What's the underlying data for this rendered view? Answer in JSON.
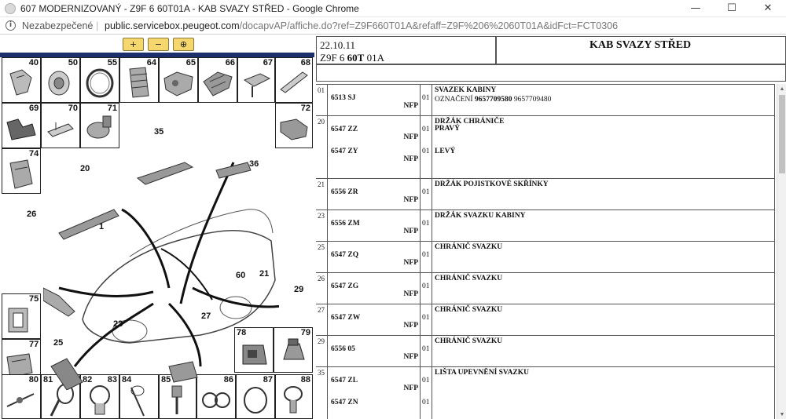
{
  "window": {
    "title": "607 MODERNIZOVANÝ - Z9F 6 60T01A - KAB SVAZY STŘED - Google Chrome",
    "minimize": "—",
    "maximize": "☐",
    "close": "✕"
  },
  "address": {
    "security": "Nezabezpečené",
    "separator": "|",
    "host": "public.servicebox.peugeot.com",
    "path": "/docapvAP/affiche.do?ref=Z9F660T01A&refaff=Z9F%206%2060T01A&idFct=FCT0306"
  },
  "toolbar": {
    "zoom_in": "+",
    "zoom_out": "−",
    "zoom_fit": "⊕"
  },
  "diagram": {
    "cells": [
      {
        "num": "40"
      },
      {
        "num": "50"
      },
      {
        "num": "55"
      },
      {
        "num": "64"
      },
      {
        "num": "65"
      },
      {
        "num": "66"
      },
      {
        "num": "67"
      },
      {
        "num": "68"
      },
      {
        "num": "69"
      },
      {
        "num": "70"
      },
      {
        "num": "71"
      },
      {
        "num": "72"
      },
      {
        "num": "74"
      },
      {
        "num": "75"
      },
      {
        "num": "77"
      },
      {
        "num": "78"
      },
      {
        "num": "79"
      },
      {
        "num": "80"
      },
      {
        "num": "81"
      },
      {
        "num": "82"
      },
      {
        "num": "83"
      },
      {
        "num": "84"
      },
      {
        "num": "85"
      },
      {
        "num": "86"
      },
      {
        "num": "87"
      },
      {
        "num": "88"
      }
    ],
    "callouts": [
      "35",
      "36",
      "20",
      "26",
      "1",
      "60",
      "21",
      "29",
      "23",
      "27",
      "25"
    ]
  },
  "header": {
    "date": "22.10.11",
    "code_prefix": "Z9F 6 ",
    "code_bold": "60T",
    "code_suffix": " 01A",
    "title": "KAB SVAZY STŘED"
  },
  "parts": [
    {
      "idx": "01",
      "ref": "6513 SJ",
      "nfp": "NFP",
      "qty": "01",
      "desc": "SVAZEK KABINY",
      "sub_label": "OZNAČENÍ",
      "sub_bold": "9657709580",
      "sub_rest": "9657709480"
    },
    {
      "idx": "20",
      "ref": "6547 ZZ",
      "nfp": "NFP",
      "qty": "01",
      "desc": "DRŽÁK CHRÁNIČE",
      "sub": "PRAVÝ",
      "ref2": "6547 ZY",
      "nfp2": "NFP",
      "qty2": "01",
      "desc2": "LEVÝ"
    },
    {
      "idx": "21",
      "ref": "6556 ZR",
      "nfp": "NFP",
      "qty": "01",
      "desc": "DRŽÁK POJISTKOVÉ SKŘÍNKY"
    },
    {
      "idx": "23",
      "ref": "6556 ZM",
      "nfp": "NFP",
      "qty": "01",
      "desc": "DRŽÁK SVAZKU KABINY"
    },
    {
      "idx": "25",
      "ref": "6547 ZQ",
      "nfp": "NFP",
      "qty": "01",
      "desc": "CHRÁNIČ SVAZKU"
    },
    {
      "idx": "26",
      "ref": "6547 ZG",
      "nfp": "NFP",
      "qty": "01",
      "desc": "CHRÁNIČ SVAZKU"
    },
    {
      "idx": "27",
      "ref": "6547 ZW",
      "nfp": "NFP",
      "qty": "01",
      "desc": "CHRÁNIČ SVAZKU"
    },
    {
      "idx": "29",
      "ref": "6556 05",
      "nfp": "NFP",
      "qty": "01",
      "desc": "CHRÁNIČ SVAZKU"
    },
    {
      "idx": "35",
      "ref": "6547 ZL",
      "nfp": "NFP",
      "qty": "01",
      "desc": "LIŠTA UPEVNĚNÍ SVAZKU",
      "ref2": "6547 ZN",
      "qty2": "01"
    }
  ]
}
